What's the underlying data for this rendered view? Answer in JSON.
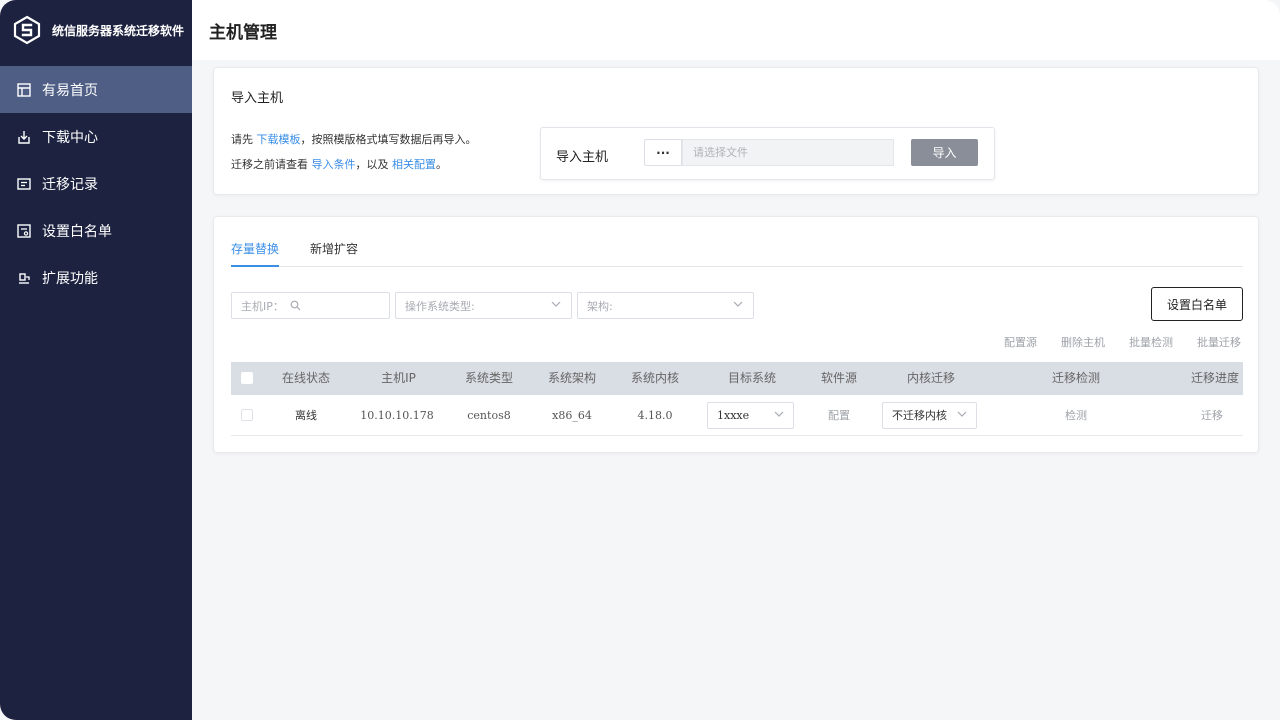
{
  "app": {
    "brand_name": "统信服务器系统迁移软件"
  },
  "sidebar": {
    "items": [
      {
        "label": "有易首页",
        "icon": "dashboard-icon",
        "active": true
      },
      {
        "label": "下载中心",
        "icon": "download-icon",
        "active": false
      },
      {
        "label": "迁移记录",
        "icon": "record-icon",
        "active": false
      },
      {
        "label": "设置白名单",
        "icon": "whitelist-icon",
        "active": false
      },
      {
        "label": "扩展功能",
        "icon": "extension-icon",
        "active": false
      }
    ]
  },
  "header": {
    "title": "主机管理"
  },
  "import": {
    "title": "导入主机",
    "hint1_pre": "请先 ",
    "hint1_link": "下载模板",
    "hint1_post": "，按照模版格式填写数据后再导入。",
    "hint2_pre": "迁移之前请查看 ",
    "hint2_link1": "导入条件",
    "hint2_mid": "，以及 ",
    "hint2_link2": "相关配置",
    "hint2_post": "。",
    "box_label": "导入主机",
    "browse_label": "···",
    "file_placeholder": "请选择文件",
    "import_button": "导入"
  },
  "tabs": [
    {
      "label": "存量替换",
      "active": true
    },
    {
      "label": "新增扩容",
      "active": false
    }
  ],
  "filters": {
    "host_ip_placeholder": "主机IP：",
    "os_type_placeholder": "操作系统类型:",
    "arch_placeholder": "架构:"
  },
  "whitelist_button": "设置白名单",
  "actions": [
    "配置源",
    "删除主机",
    "批量检测",
    "批量迁移"
  ],
  "table": {
    "columns": [
      "在线状态",
      "主机IP",
      "系统类型",
      "系统架构",
      "系统内核",
      "目标系统",
      "软件源",
      "内核迁移",
      "迁移检测",
      "迁移进度"
    ],
    "rows": [
      {
        "status": "离线",
        "ip": "10.10.10.178",
        "os_type": "centos8",
        "arch": "x86_64",
        "kernel": "4.18.0",
        "target": "1xxxe",
        "source": "配置",
        "kernel_migrate": "不迁移内核",
        "check": "检测",
        "progress": "迁移"
      }
    ]
  },
  "colors": {
    "sidebar_bg": "#1c2240",
    "sidebar_active": "#4e5e85",
    "accent": "#3a8ee6"
  }
}
